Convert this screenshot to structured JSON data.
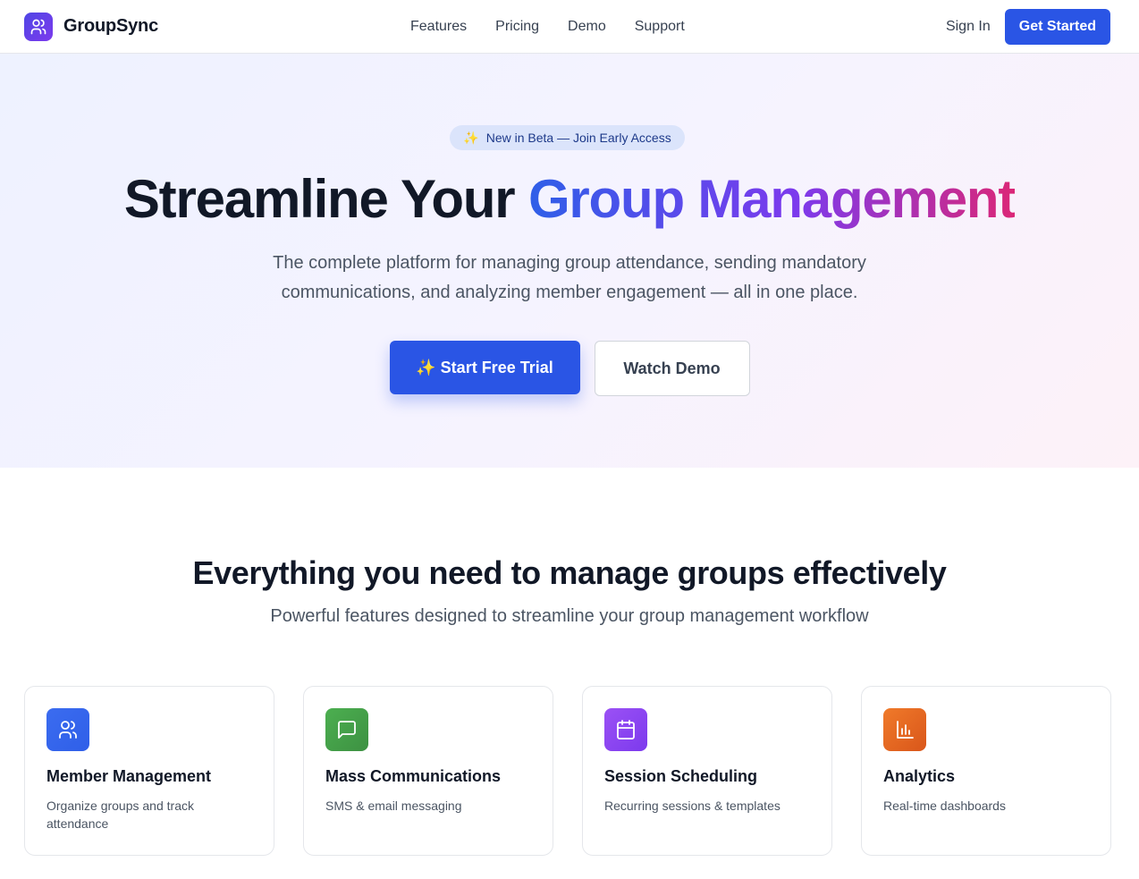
{
  "nav": {
    "brand": "GroupSync",
    "links": [
      "Features",
      "Pricing",
      "Demo",
      "Support"
    ],
    "signin": "Sign In",
    "cta": "Get Started"
  },
  "hero": {
    "badge_icon": "✨",
    "badge_text": "New in Beta — Join Early Access",
    "headline_plain": "Streamline Your ",
    "headline_gradient": "Group Management",
    "subtitle": "The complete platform for managing group attendance, sending mandatory communications, and analyzing member engagement — all in one place.",
    "primary_cta": "✨ Start Free Trial",
    "secondary_cta": "Watch Demo"
  },
  "features": {
    "title": "Everything you need to manage groups effectively",
    "subtitle": "Powerful features designed to streamline your group management workflow",
    "cards": [
      {
        "icon": "users-icon",
        "title": "Member Management",
        "desc": "Organize groups and track attendance",
        "color": "#3b6cf0"
      },
      {
        "icon": "message-icon",
        "title": "Mass Communications",
        "desc": "SMS & email messaging",
        "color": "#43a047"
      },
      {
        "icon": "calendar-icon",
        "title": "Session Scheduling",
        "desc": "Recurring sessions & templates",
        "color": "#8b45f0"
      },
      {
        "icon": "bar-chart-icon",
        "title": "Analytics",
        "desc": "Real-time dashboards",
        "color": "#e8651d"
      }
    ]
  },
  "colors": {
    "primary": "#2a55e5",
    "heading": "#111827",
    "body": "#4b5563"
  }
}
